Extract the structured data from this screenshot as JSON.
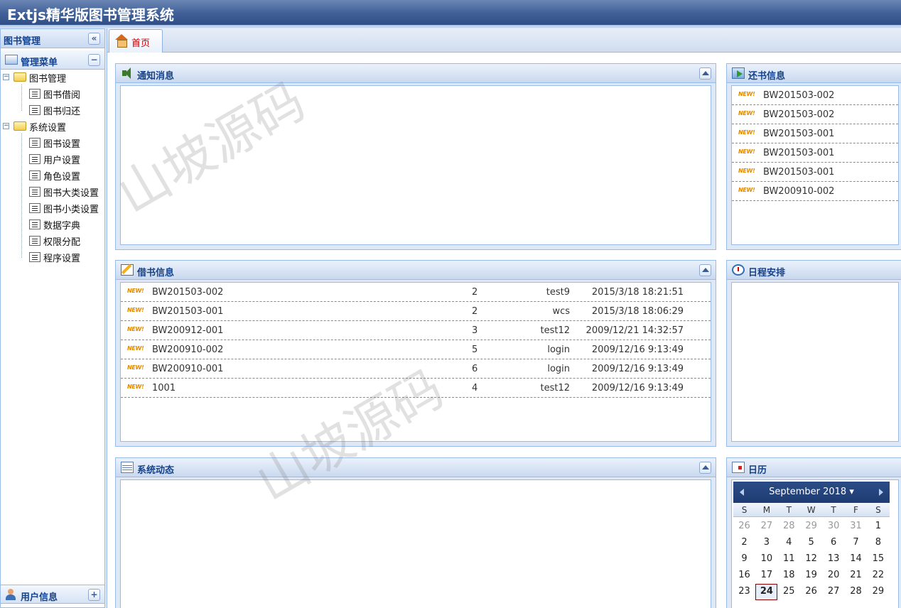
{
  "app": {
    "title": "Extjs精华版图书管理系统"
  },
  "west": {
    "title": "图书管理",
    "collapse_glyph": "«",
    "menu": {
      "title": "管理菜单",
      "toggle_glyph": "−"
    },
    "tree": [
      {
        "label": "图书管理",
        "type": "folder",
        "children": [
          "图书借阅",
          "图书归还"
        ]
      },
      {
        "label": "系统设置",
        "type": "folder",
        "children": [
          "图书设置",
          "用户设置",
          "角色设置",
          "图书大类设置",
          "图书小类设置",
          "数据字典",
          "权限分配",
          "程序设置"
        ]
      }
    ],
    "user": {
      "title": "用户信息",
      "toggle_glyph": "+"
    }
  },
  "tabs": [
    {
      "label": "首页",
      "icon": "home-icon",
      "active": true
    }
  ],
  "portlets": {
    "notice": {
      "title": "通知消息",
      "icon": "speaker-icon"
    },
    "return": {
      "title": "还书信息",
      "icon": "return-icon",
      "badge": "NEW!",
      "items": [
        "BW201503-002",
        "BW201503-002",
        "BW201503-001",
        "BW201503-001",
        "BW201503-001",
        "BW200910-002"
      ]
    },
    "borrow": {
      "title": "借书信息",
      "icon": "edit-icon",
      "badge": "NEW!",
      "rows": [
        {
          "code": "BW201503-002",
          "num": "2",
          "user": "test9",
          "date": "2015/3/18 18:21:51"
        },
        {
          "code": "BW201503-001",
          "num": "2",
          "user": "wcs",
          "date": "2015/3/18 18:06:29"
        },
        {
          "code": "BW200912-001",
          "num": "3",
          "user": "test12",
          "date": "2009/12/21 14:32:57"
        },
        {
          "code": "BW200910-002",
          "num": "5",
          "user": "login",
          "date": "2009/12/16 9:13:49"
        },
        {
          "code": "BW200910-001",
          "num": "6",
          "user": "login",
          "date": "2009/12/16 9:13:49"
        },
        {
          "code": "1001",
          "num": "4",
          "user": "test12",
          "date": "2009/12/16 9:13:49"
        }
      ]
    },
    "schedule": {
      "title": "日程安排",
      "icon": "clock-icon"
    },
    "sysdyn": {
      "title": "系统动态",
      "icon": "table-icon"
    },
    "calendar": {
      "title": "日历",
      "icon": "calendar-icon",
      "month_label": "September 2018 ▾",
      "dows": [
        "S",
        "M",
        "T",
        "W",
        "T",
        "F",
        "S"
      ],
      "weeks": [
        [
          "26",
          "27",
          "28",
          "29",
          "30",
          "31",
          "1"
        ],
        [
          "2",
          "3",
          "4",
          "5",
          "6",
          "7",
          "8"
        ],
        [
          "9",
          "10",
          "11",
          "12",
          "13",
          "14",
          "15"
        ],
        [
          "16",
          "17",
          "18",
          "19",
          "20",
          "21",
          "22"
        ],
        [
          "23",
          "24",
          "25",
          "26",
          "27",
          "28",
          "29"
        ]
      ],
      "prev_month_days_in_first_week": 6,
      "today": "24"
    }
  },
  "watermark": "山坡源码",
  "colors": {
    "header": "#3f5f96",
    "panel_title": "#15428b",
    "tab_text": "#cc0000",
    "badge": "#e08a00",
    "accent_border": "#99bbe8"
  }
}
